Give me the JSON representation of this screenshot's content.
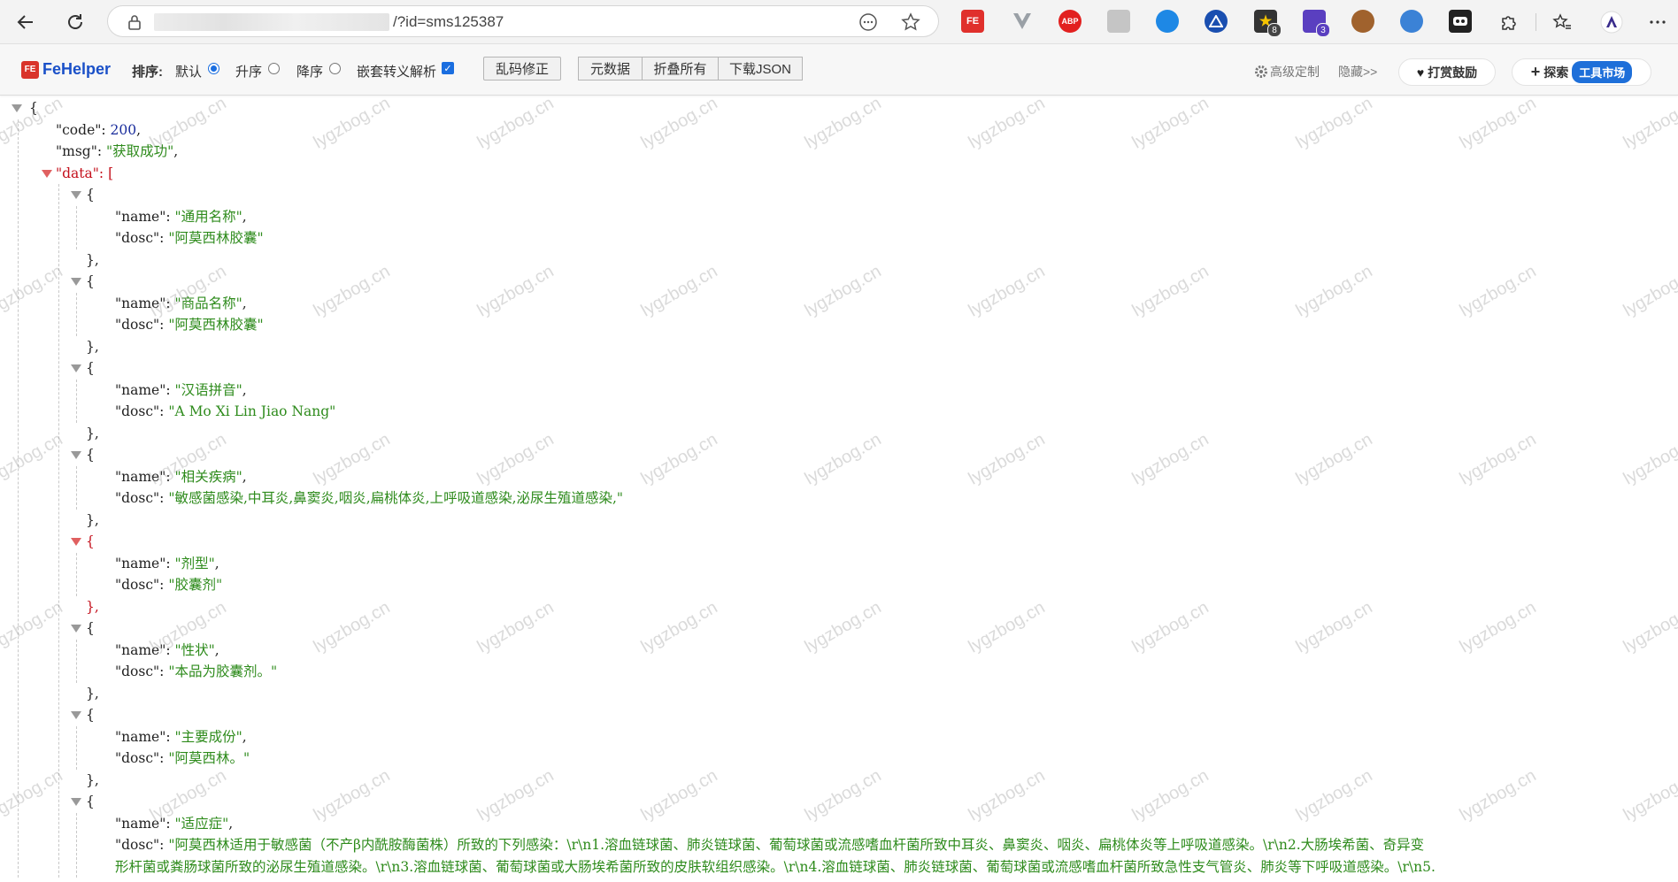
{
  "browser": {
    "url": "/?id=sms125387",
    "extensions": [
      {
        "name": "fehelper-ext-icon",
        "label": "FE",
        "color": "#e0302c",
        "badge": ""
      },
      {
        "name": "vue-devtools-icon",
        "label": "",
        "color": "#9aa0a6",
        "badge": ""
      },
      {
        "name": "adblock-plus-icon",
        "label": "ABP",
        "color": "#e2201f",
        "badge": ""
      },
      {
        "name": "react-devtools-icon",
        "label": "",
        "color": "#c5c5c5",
        "badge": ""
      },
      {
        "name": "media-ext-icon",
        "label": "",
        "color": "#1e88e5",
        "badge": ""
      },
      {
        "name": "triangle-ext-icon",
        "label": "",
        "color": "#1a4fb0",
        "badge": ""
      },
      {
        "name": "star-ext-icon",
        "label": "",
        "color": "#333333",
        "badge": "8"
      },
      {
        "name": "cube-ext-icon",
        "label": "",
        "color": "#5a3fc0",
        "badge": "3"
      },
      {
        "name": "cookie-ext-icon",
        "label": "",
        "color": "#a0622d",
        "badge": ""
      },
      {
        "name": "molecule-ext-icon",
        "label": "",
        "color": "#3b82d6",
        "badge": ""
      },
      {
        "name": "mask-ext-icon",
        "label": "",
        "color": "#222222",
        "badge": ""
      }
    ]
  },
  "toolbar": {
    "logo": "FeHelper",
    "logo_box": "FE",
    "sort_label": "排序:",
    "sort_default": "默认",
    "sort_asc": "升序",
    "sort_desc": "降序",
    "nested_escape": "嵌套转义解析",
    "fix_garbled": "乱码修正",
    "raw_data": "元数据",
    "collapse_all": "折叠所有",
    "download_json": "下载JSON",
    "advanced": "高级定制",
    "hide": "隐藏>>",
    "donate": "打赏鼓励",
    "explore": "探索",
    "tool_market": "工具市场"
  },
  "watermark": "lygzbog.cn",
  "json": {
    "code": 200,
    "msg": "获取成功",
    "data": [
      {
        "name": "通用名称",
        "dosc": "阿莫西林胶囊"
      },
      {
        "name": "商品名称",
        "dosc": "阿莫西林胶囊"
      },
      {
        "name": "汉语拼音",
        "dosc": "A Mo Xi Lin Jiao Nang"
      },
      {
        "name": "相关疾病",
        "dosc": "敏感菌感染,中耳炎,鼻窦炎,咽炎,扁桃体炎,上呼吸道感染,泌尿生殖道感染,"
      },
      {
        "name": "剂型",
        "dosc": "胶囊剂"
      },
      {
        "name": "性状",
        "dosc": "本品为胶囊剂。"
      },
      {
        "name": "主要成份",
        "dosc": "阿莫西林。"
      },
      {
        "name": "适应症",
        "dosc_line1": "阿莫西林适用于敏感菌（不产β内酰胺酶菌株）所致的下列感染：\\r\\n1.溶血链球菌、肺炎链球菌、葡萄球菌或流感嗜血杆菌所致中耳炎、鼻窦炎、咽炎、扁桃体炎等上呼吸道感染。\\r\\n2.大肠埃希菌、奇异变",
        "dosc_line2": "形杆菌或粪肠球菌所致的泌尿生殖道感染。\\r\\n3.溶血链球菌、葡萄球菌或大肠埃希菌所致的皮肤软组织感染。\\r\\n4.溶血链球菌、肺炎链球菌、葡萄球菌或流感嗜血杆菌所致急性支气管炎、肺炎等下呼吸道感染。\\r\\n5."
      }
    ]
  }
}
